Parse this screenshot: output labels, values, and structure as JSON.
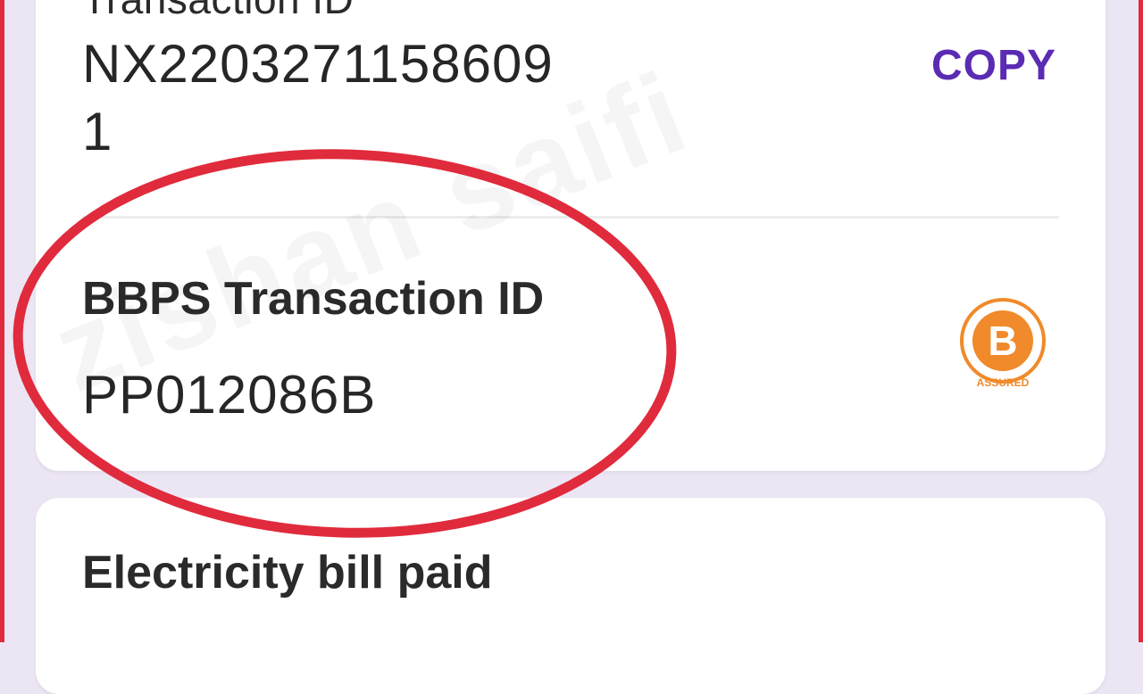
{
  "transaction": {
    "label": "Transaction ID",
    "value": "NX22032711586091",
    "copy_label": "COPY"
  },
  "bbps": {
    "label": "BBPS Transaction ID",
    "value": "PP012086B",
    "logo_letter": "B",
    "logo_caption": "ASSURED"
  },
  "bill": {
    "title": "Electricity bill paid"
  },
  "watermark": "zishan saifi",
  "colors": {
    "accent": "#5b2bb3",
    "highlight": "#e02b3c",
    "bbps_orange": "#f08a2a",
    "background": "#ece5f4"
  }
}
